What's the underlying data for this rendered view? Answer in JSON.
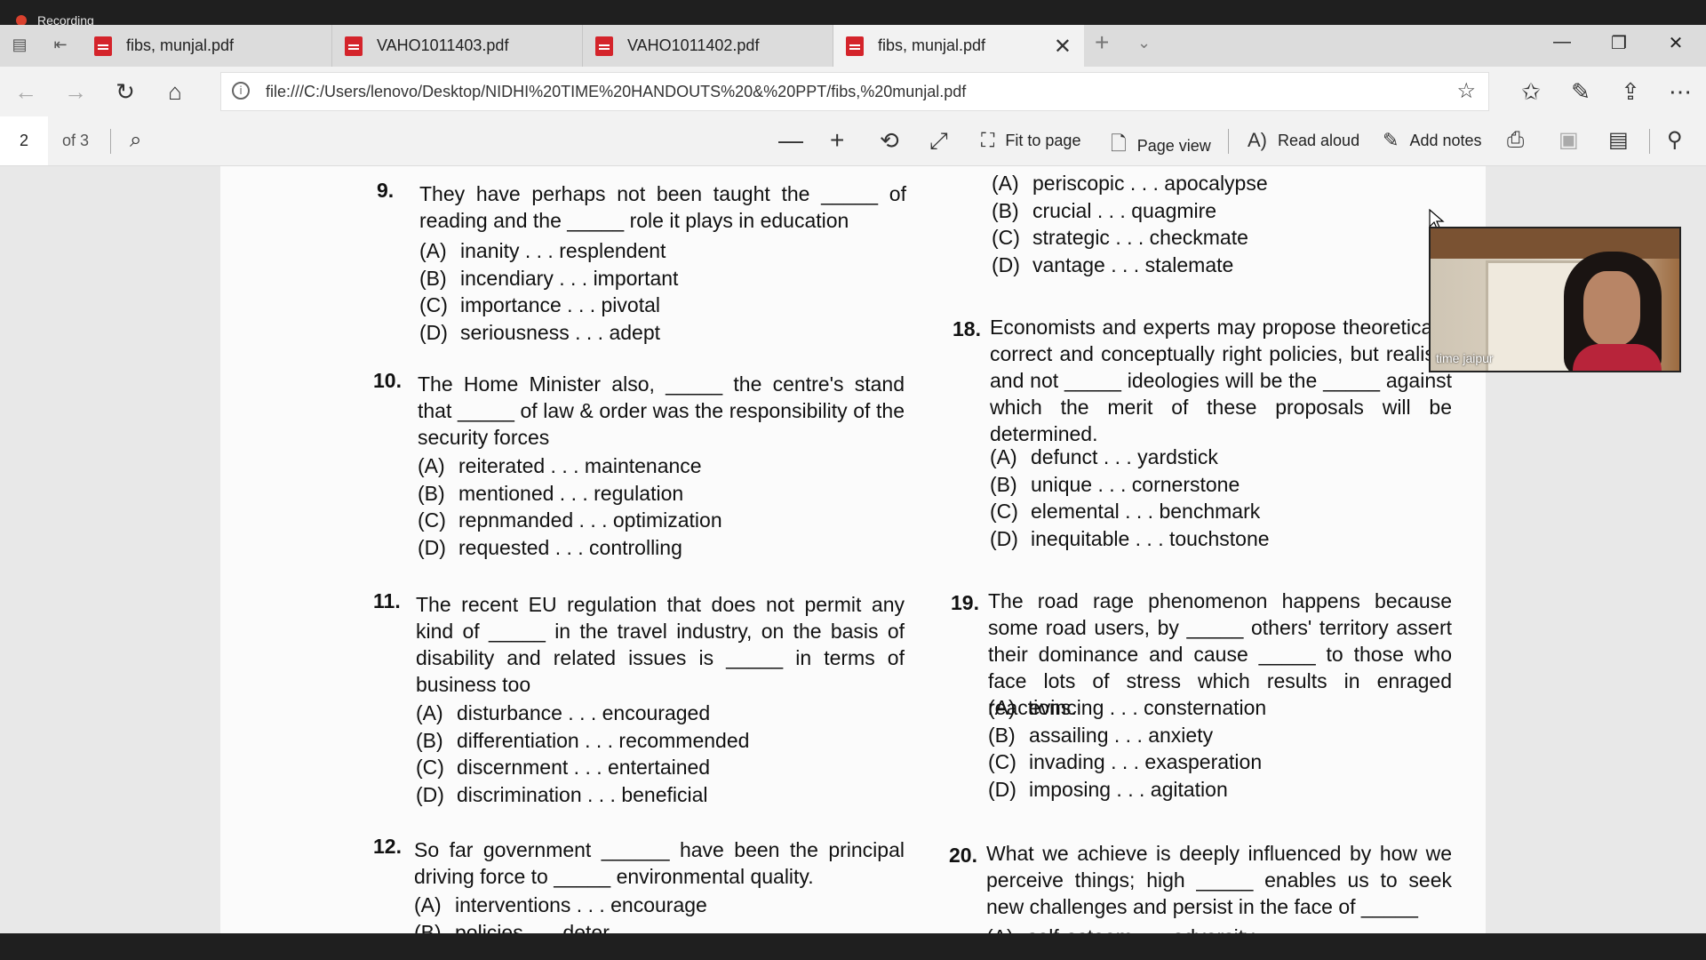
{
  "recording": {
    "label": "Recording"
  },
  "tabs": [
    {
      "label": "fibs, munjal.pdf",
      "active": false
    },
    {
      "label": "VAHO1011403.pdf",
      "active": false
    },
    {
      "label": "VAHO1011402.pdf",
      "active": false
    },
    {
      "label": "fibs, munjal.pdf",
      "active": true
    }
  ],
  "address": {
    "url": "file:///C:/Users/lenovo/Desktop/NIDHI%20TIME%20HANDOUTS%20&%20PPT/fibs,%20munjal.pdf"
  },
  "pdf_toolbar": {
    "current_page": "2",
    "page_total": "of 3",
    "fit_to_page": "Fit to page",
    "page_view": "Page view",
    "read_aloud": "Read aloud",
    "add_notes": "Add notes"
  },
  "questions_left": [
    {
      "num": "9.",
      "text": "They have perhaps not been taught the _____ of reading and the _____ role it plays in education",
      "options": [
        {
          "letter": "(A)",
          "text": "inanity . . . resplendent"
        },
        {
          "letter": "(B)",
          "text": "incendiary . . . important"
        },
        {
          "letter": "(C)",
          "text": "importance . . . pivotal"
        },
        {
          "letter": "(D)",
          "text": "seriousness . . . adept"
        }
      ]
    },
    {
      "num": "10.",
      "text": "The Home Minister also, _____ the centre's stand that _____ of law & order was the responsibility of the security forces",
      "options": [
        {
          "letter": "(A)",
          "text": "reiterated . . . maintenance"
        },
        {
          "letter": "(B)",
          "text": "mentioned . . . regulation"
        },
        {
          "letter": "(C)",
          "text": "repnmanded . . . optimization"
        },
        {
          "letter": "(D)",
          "text": "requested . . . controlling"
        }
      ]
    },
    {
      "num": "11.",
      "text": "The recent EU regulation that does not permit any kind of _____ in the travel industry, on the basis of disability and related issues is _____ in terms of business too",
      "options": [
        {
          "letter": "(A)",
          "text": "disturbance . . . encouraged"
        },
        {
          "letter": "(B)",
          "text": "differentiation . . . recommended"
        },
        {
          "letter": "(C)",
          "text": "discernment . . . entertained"
        },
        {
          "letter": "(D)",
          "text": "discrimination . . . beneficial"
        }
      ]
    },
    {
      "num": "12.",
      "text": "So far government ______ have been the principal driving force to _____ environmental quality.",
      "options": [
        {
          "letter": "(A)",
          "text": "interventions . . . encourage"
        },
        {
          "letter": "(B)",
          "text": "policies . . . deter"
        }
      ]
    }
  ],
  "questions_right": [
    {
      "num": "",
      "text": "",
      "options": [
        {
          "letter": "(A)",
          "text": "periscopic . . . apocalypse"
        },
        {
          "letter": "(B)",
          "text": "crucial . . . quagmire"
        },
        {
          "letter": "(C)",
          "text": "strategic . . . checkmate"
        },
        {
          "letter": "(D)",
          "text": "vantage . . . stalemate"
        }
      ]
    },
    {
      "num": "18.",
      "text": "Economists and experts may propose theoretically correct and conceptually right policies, but realism and not _____ ideologies will be the _____ against which the merit of these proposals will be determined.",
      "options": [
        {
          "letter": "(A)",
          "text": "defunct . . . yardstick"
        },
        {
          "letter": "(B)",
          "text": "unique . . . cornerstone"
        },
        {
          "letter": "(C)",
          "text": "elemental . . . benchmark"
        },
        {
          "letter": "(D)",
          "text": "inequitable . . . touchstone"
        }
      ]
    },
    {
      "num": "19.",
      "text": "The road rage phenomenon happens because some road users, by _____ others' territory assert their dominance and cause _____ to those who face lots of stress which results in enraged reactions.",
      "options": [
        {
          "letter": "(A)",
          "text": "evincing . . . consternation"
        },
        {
          "letter": "(B)",
          "text": "assailing . . . anxiety"
        },
        {
          "letter": "(C)",
          "text": "invading . . . exasperation"
        },
        {
          "letter": "(D)",
          "text": "imposing . . . agitation"
        }
      ]
    },
    {
      "num": "20.",
      "text": "What we achieve is deeply influenced by how we perceive things; high _____ enables us to seek new challenges and persist in the face of _____",
      "options": [
        {
          "letter": "(A)",
          "text": "self-esteem . . . adversity"
        }
      ]
    }
  ],
  "webcam": {
    "name": "time jaipur"
  }
}
